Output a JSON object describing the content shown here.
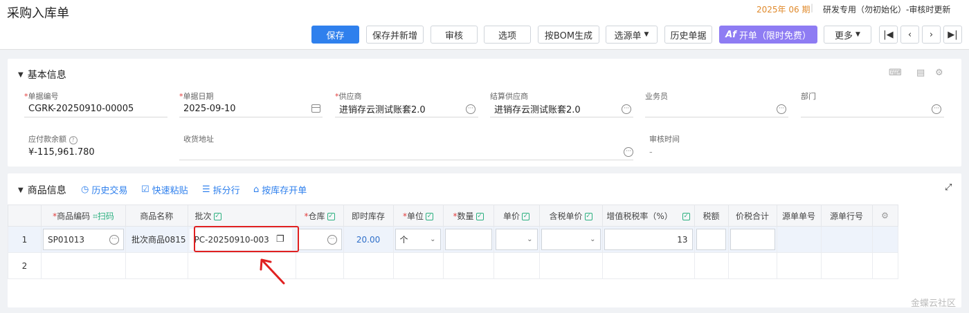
{
  "header": {
    "title": "采购入库单",
    "period": "2025年 06 期",
    "org": "研发专用（勿初始化）-审核时更新"
  },
  "toolbar": {
    "save": "保存",
    "save_new": "保存并新增",
    "audit": "审核",
    "options": "选项",
    "bom": "按BOM生成",
    "source": "选源单",
    "history": "历史单据",
    "kaidan": "开单（限时免费）",
    "more": "更多"
  },
  "basic": {
    "title": "基本信息",
    "fields": {
      "bill_no": {
        "label": "单据编号",
        "value": "CGRK-20250910-00005"
      },
      "bill_date": {
        "label": "单据日期",
        "value": "2025-09-10"
      },
      "supplier": {
        "label": "供应商",
        "value": "进销存云测试账套2.0"
      },
      "settle_supplier": {
        "label": "结算供应商",
        "value": "进销存云测试账套2.0"
      },
      "salesman": {
        "label": "业务员",
        "value": ""
      },
      "dept": {
        "label": "部门",
        "value": ""
      },
      "payable": {
        "label": "应付款余额",
        "value": "¥-115,961.780"
      },
      "address": {
        "label": "收货地址",
        "value": ""
      },
      "audit_time": {
        "label": "审核时间",
        "value": "-"
      }
    }
  },
  "goods": {
    "title": "商品信息",
    "actions": {
      "history_trade": "历史交易",
      "quick_paste": "快速粘贴",
      "split_row": "拆分行",
      "by_stock": "按库存开单"
    },
    "columns": {
      "code": "商品编码",
      "scan": "扫码",
      "name": "商品名称",
      "batch": "批次",
      "warehouse": "仓库",
      "stock": "即时库存",
      "unit": "单位",
      "qty": "数量",
      "price": "单价",
      "tax_price": "含税单价",
      "tax_rate": "增值税税率（%）",
      "tax": "税额",
      "total": "价税合计",
      "src_no": "源单单号",
      "src_line": "源单行号"
    },
    "rows": [
      {
        "no": "1",
        "code": "SP01013",
        "name": "批次商品0815",
        "batch": "PC-20250910-003",
        "stock": "20.00",
        "unit": "个",
        "tax_rate": "13"
      },
      {
        "no": "2"
      }
    ]
  },
  "watermark": "金蝶云社区",
  "colors": {
    "primary": "#2f80ed",
    "purple": "#8e7cf3",
    "highlight": "#e02020",
    "period": "#e08a2c"
  }
}
